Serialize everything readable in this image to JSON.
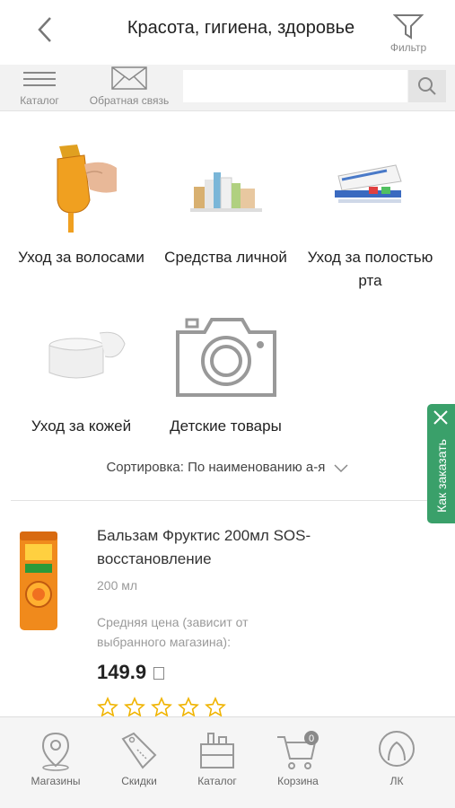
{
  "header": {
    "title": "Красота, гигиена, здоровье",
    "filter_label": "Фильтр"
  },
  "toolbar": {
    "catalog_label": "Каталог",
    "feedback_label": "Обратная связь",
    "search_value": ""
  },
  "categories": [
    {
      "label": "Уход за волосами",
      "icon": "hair-care-image"
    },
    {
      "label": "Средства личной",
      "icon": "personal-care-image"
    },
    {
      "label": "Уход за полостью рта",
      "icon": "oral-care-image"
    },
    {
      "label": "Уход за кожей",
      "icon": "skin-care-image"
    },
    {
      "label": "Детские товары",
      "icon": "camera-placeholder-icon"
    }
  ],
  "sort": {
    "label": "Сортировка:",
    "value": "По наименованию а-я"
  },
  "product": {
    "name": "Бальзам Фруктис 200мл SOS-восстановление",
    "volume": "200 мл",
    "price_note": "Средняя цена (зависит от выбранного магазина):",
    "price": "149.9",
    "rating_stars": 0,
    "rating_max": 5
  },
  "side_tab": {
    "label": "Как заказать"
  },
  "bottom_nav": {
    "stores": "Магазины",
    "discounts": "Скидки",
    "catalog": "Каталог",
    "cart": "Корзина",
    "cart_count": "0",
    "account": "ЛК"
  },
  "colors": {
    "accent_green": "#3aa06a",
    "star_yellow": "#f0b400",
    "product_orange": "#f08a1c"
  }
}
